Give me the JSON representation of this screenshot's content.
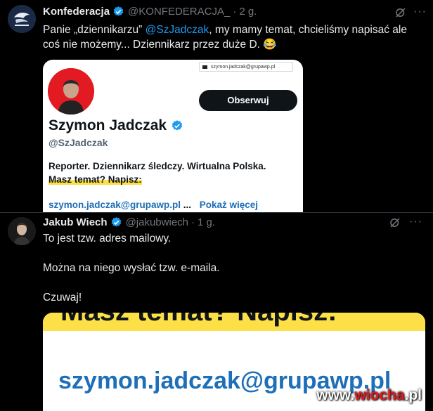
{
  "post1": {
    "author_name": "Konfederacja",
    "author_handle": "@KONFEDERACJA_",
    "time": "2 g.",
    "text_before": "Panie „dziennikarzu” ",
    "mention": "@SzJadczak",
    "text_after": ", my mamy temat, chcieliśmy napisać ale coś nie możemy... Dziennikarz przez duże D. 😂",
    "embed": {
      "url": "szymon.jadczak@grupawp.pl",
      "follow_label": "Obserwuj",
      "name": "Szymon Jadczak",
      "handle": "@SzJadczak",
      "bio_line1": "Reporter. Dziennikarz śledczy. Wirtualna Polska.",
      "bio_line2": "Masz temat? Napisz:",
      "link": "szymon.jadczak@grupawp.pl",
      "link_sep": "...",
      "show_more": "Pokaż więcej"
    }
  },
  "post2": {
    "author_name": "Jakub Wiech",
    "author_handle": "@jakubwiech",
    "time": "1 g.",
    "line1": "To jest tzw. adres mailowy.",
    "line2": "Można na niego wysłać tzw. e-maila.",
    "line3": "Czuwaj!",
    "embed": {
      "top_text": "Masz temat? Napisz:",
      "email": "szymon.jadczak@grupawp.pl"
    }
  },
  "watermark": {
    "prefix": "www.",
    "accent": "wiocha",
    "suffix": ".pl"
  },
  "colors": {
    "link": "#1d9bf0",
    "verified": "#1d9bf0",
    "highlight": "#fde047"
  }
}
